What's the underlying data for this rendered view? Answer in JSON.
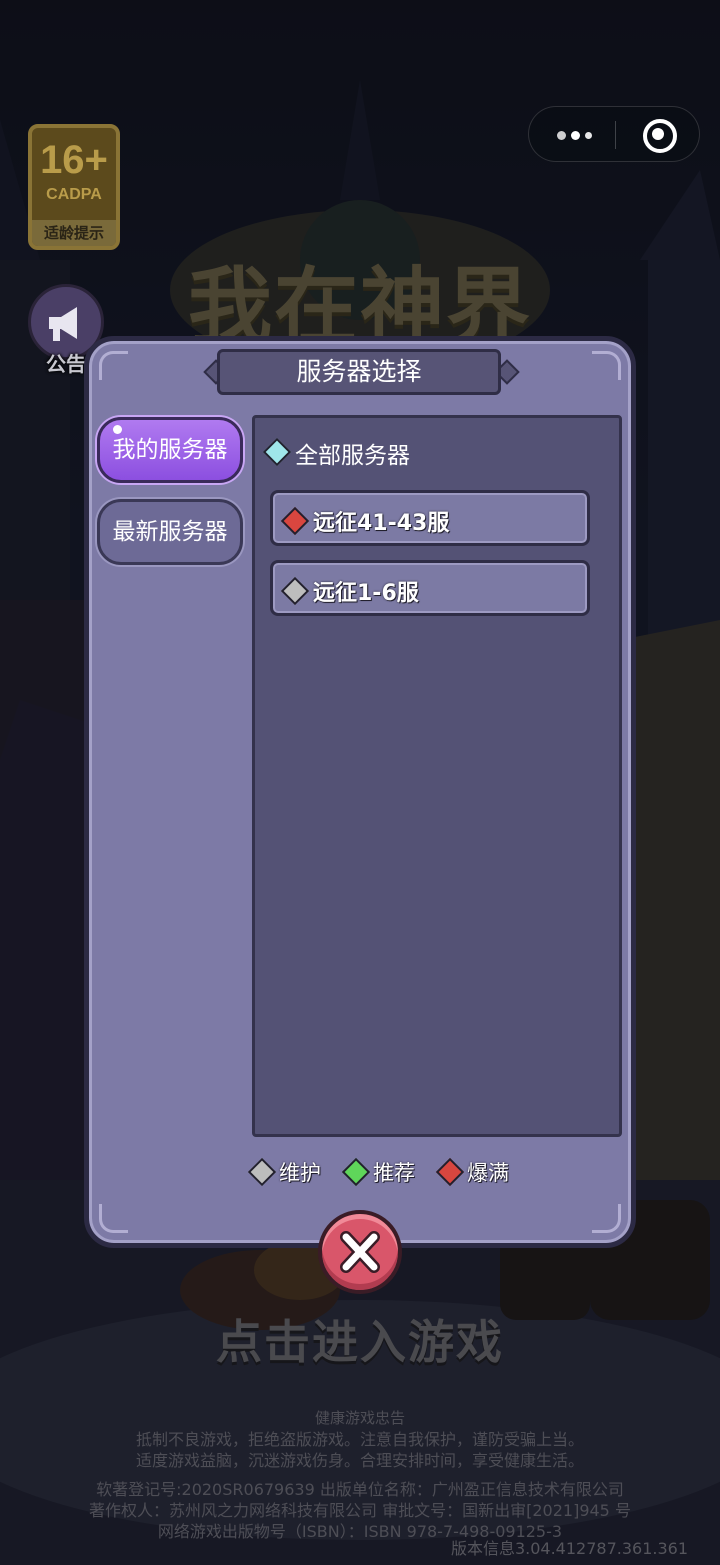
{
  "age_badge": {
    "rating": "16+",
    "org": "CADPA",
    "tip": "适龄提示"
  },
  "notice": {
    "label": "公告"
  },
  "game_title": "我在神界",
  "modal": {
    "title": "服务器选择",
    "tabs": [
      {
        "label": "我的服务器",
        "active": true
      },
      {
        "label": "最新服务器",
        "active": false
      }
    ],
    "all_servers_label": "全部服务器",
    "servers": [
      {
        "name": "远征41-43服",
        "status": "爆满"
      },
      {
        "name": "远征1-6服",
        "status": "维护"
      }
    ],
    "legend": [
      {
        "label": "维护",
        "color": "#bdbdbd"
      },
      {
        "label": "推荐",
        "color": "#5fd65a"
      },
      {
        "label": "爆满",
        "color": "#d9463f"
      }
    ]
  },
  "enter_game": "点击进入游戏",
  "footer": {
    "title": "健康游戏忠告",
    "line1": "抵制不良游戏，拒绝盗版游戏。注意自我保护，谨防受骗上当。",
    "line2": "适度游戏益脑，沉迷游戏伤身。合理安排时间，享受健康生活。",
    "line3": "软著登记号:2020SR0679639 出版单位名称：广州盈正信息技术有限公司",
    "line4": "著作权人：苏州风之力网络科技有限公司 审批文号：国新出审[2021]945 号",
    "line5": "网络游戏出版物号（ISBN）：ISBN 978-7-498-09125-3",
    "version": "版本信息3.04.412787.361.361"
  },
  "colors": {
    "gem_all": "#9fe6ea",
    "gem_full": "#d9463f",
    "gem_maintenance": "#bdbdbd",
    "gem_recommend": "#5fd65a",
    "tab_active": "#9a5eea",
    "modal_bg": "#7d7aa6",
    "close_button": "#d9566a"
  },
  "icons": [
    "more-dots-icon",
    "target-close-icon",
    "megaphone-icon",
    "diamond-gem-icon",
    "x-close-icon"
  ]
}
